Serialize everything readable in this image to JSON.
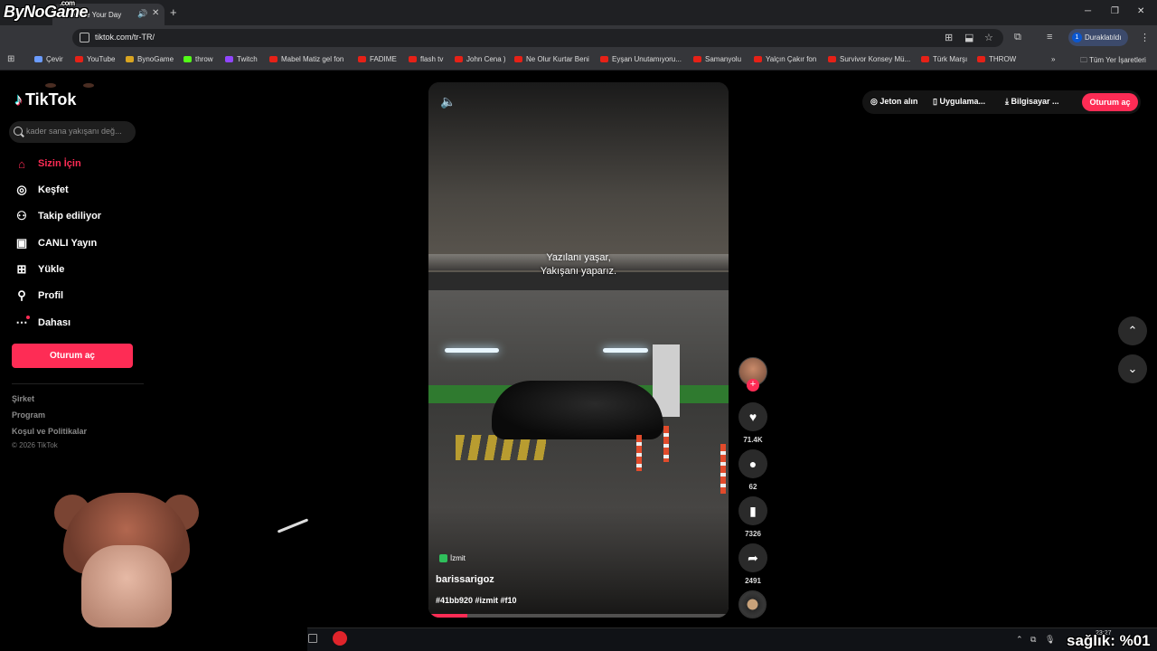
{
  "browser": {
    "stream_logo": "ByNoGame",
    "stream_logo_sup": ".com",
    "tab_title": "Make Your Day",
    "url": "tiktok.com/tr-TR/",
    "profile_label": "Duraklatıldı",
    "profile_initial": "1",
    "bookmarks": [
      {
        "label": "Çevir",
        "icon": "translate"
      },
      {
        "label": "YouTube",
        "icon": "youtube"
      },
      {
        "label": "BynoGame",
        "icon": "bug"
      },
      {
        "label": "throw",
        "icon": "kick"
      },
      {
        "label": "Twitch",
        "icon": "twitch"
      },
      {
        "label": "Mabel Matiz  gel fon",
        "icon": "youtube"
      },
      {
        "label": "FADIME",
        "icon": "youtube"
      },
      {
        "label": "flash tv",
        "icon": "youtube"
      },
      {
        "label": "John Cena )",
        "icon": "youtube"
      },
      {
        "label": "Ne Olur Kurtar Beni",
        "icon": "youtube"
      },
      {
        "label": "Eyşan Unutamıyoru...",
        "icon": "youtube"
      },
      {
        "label": "Samanyolu",
        "icon": "youtube"
      },
      {
        "label": "Yalçın Çakır  fon",
        "icon": "youtube"
      },
      {
        "label": "Survivor Konsey Mü...",
        "icon": "youtube"
      },
      {
        "label": "Türk Marşı",
        "icon": "youtube"
      },
      {
        "label": "THROW",
        "icon": "youtube"
      }
    ],
    "bookmarks_overflow": "»",
    "all_bookmarks": "Tüm Yer İşaretleri"
  },
  "sidebar": {
    "logo": "TikTok",
    "search_placeholder": "kader sana yakışanı değ...",
    "nav": [
      {
        "label": "Sizin İçin",
        "icon": "home-icon",
        "active": true
      },
      {
        "label": "Keşfet",
        "icon": "compass-icon"
      },
      {
        "label": "Takip ediliyor",
        "icon": "user-follow-icon"
      },
      {
        "label": "CANLI Yayın",
        "icon": "live-tv-icon"
      },
      {
        "label": "Yükle",
        "icon": "upload-icon"
      },
      {
        "label": "Profil",
        "icon": "profile-icon"
      },
      {
        "label": "Dahası",
        "icon": "more-icon"
      }
    ],
    "login_button": "Oturum aç",
    "footer_links": [
      "Şirket",
      "Program",
      "Koşul ve Politikalar"
    ],
    "copyright": "© 2026 TikTok"
  },
  "topbar": {
    "coins": "Jeton alın",
    "app": "Uygulama...",
    "desktop": "Bilgisayar ...",
    "login": "Oturum aç"
  },
  "video": {
    "caption_line1": "Yazılanı yaşar,",
    "caption_line2": "Yakışanı yaparız.",
    "location": "İzmit",
    "username": "barissarigoz",
    "hashtags": "#41bb920 #izmit #f10",
    "progress_percent": 13
  },
  "actions": {
    "likes": "71.4K",
    "comments": "62",
    "saves": "7326",
    "shares": "2491"
  },
  "taskbar": {
    "time": "23:27",
    "overlay_text": "sağlık: %01"
  },
  "colors": {
    "accent": "#fe2c55",
    "background": "#000000",
    "chrome_dark": "#1f2023"
  }
}
